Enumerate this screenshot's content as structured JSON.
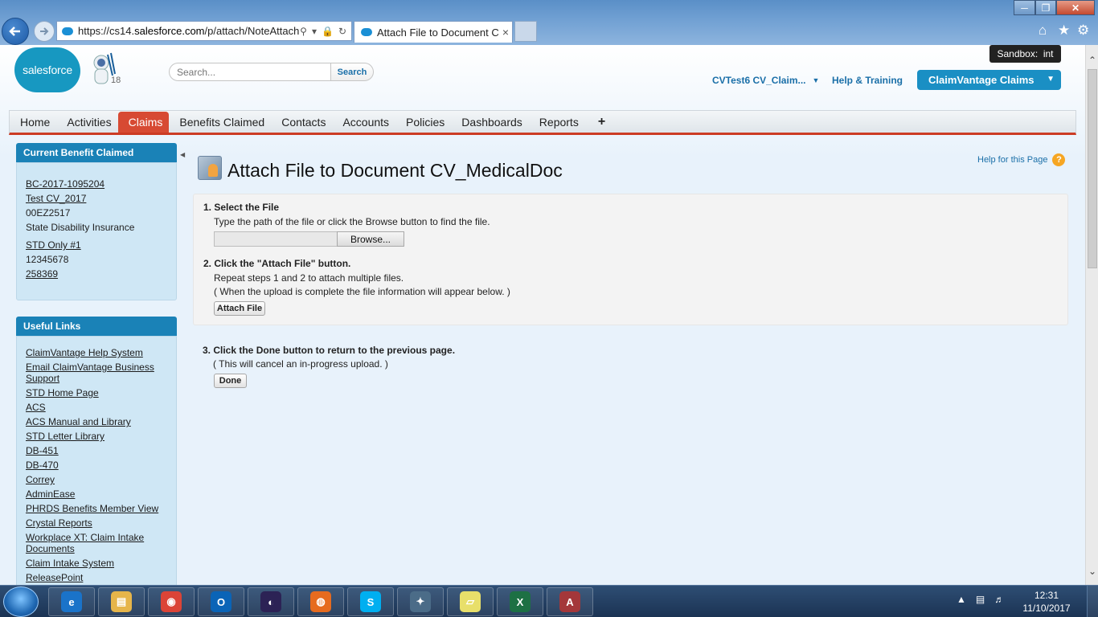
{
  "browser": {
    "url_prefix": "https://cs14.",
    "url_host": "salesforce.com",
    "url_rest": "/p/attach/NoteAttach?",
    "tab_title": "Attach File to Document C...",
    "tab_close": "×"
  },
  "header": {
    "logo_text": "salesforce",
    "mascot_count": "18",
    "search_placeholder": "Search...",
    "search_button": "Search",
    "user_menu": "CVTest6 CV_Claim...",
    "help_training": "Help & Training",
    "app_name": "ClaimVantage Claims",
    "sandbox_badge": "Sandbox:  int"
  },
  "tabs": [
    "Home",
    "Activities",
    "Claims",
    "Benefits Claimed",
    "Contacts",
    "Accounts",
    "Policies",
    "Dashboards",
    "Reports",
    "+"
  ],
  "active_tab": "Claims",
  "sidebar": {
    "current_heading": "Current Benefit Claimed",
    "current_items": [
      {
        "text": "BC-2017-1095204",
        "link": true
      },
      {
        "text": "Test CV_2017",
        "link": true
      },
      {
        "text": "00EZ2517",
        "link": false
      },
      {
        "text": "State Disability Insurance",
        "link": false
      },
      {
        "text": "STD Only #1",
        "link": true
      },
      {
        "text": "12345678",
        "link": false
      },
      {
        "text": "258369",
        "link": true
      }
    ],
    "links_heading": "Useful Links",
    "links": [
      "ClaimVantage Help System",
      "Email ClaimVantage Business Support",
      "STD Home Page",
      "ACS",
      "ACS Manual and Library",
      "STD Letter Library",
      "DB-451",
      "DB-470",
      "Correy",
      "AdminEase",
      "PHRDS Benefits Member View",
      "Crystal Reports",
      "Workplace XT: Claim Intake Documents",
      "Claim Intake System",
      "ReleasePoint"
    ]
  },
  "main": {
    "title": "Attach File to Document CV_MedicalDoc",
    "help_link": "Help for this Page",
    "help_icon": "?",
    "step1_title": "1.  Select the File",
    "step1_text": "Type the path of the file or click the Browse button to find the file.",
    "browse_button": "Browse...",
    "step2_title": "2.  Click the \"Attach File\" button.",
    "step2_text1": "Repeat steps 1 and 2 to attach multiple files.",
    "step2_text2": "( When the upload is complete the file information will appear below. )",
    "attach_button": "Attach File",
    "step3_title": "3.  Click the Done button to return to the previous page.",
    "step3_text": "( This will cancel an in-progress upload. )",
    "done_button": "Done"
  },
  "taskbar": {
    "apps": [
      "ie",
      "explorer",
      "chrome",
      "outlook",
      "eclipse",
      "firefox",
      "skype",
      "app",
      "sticky-notes",
      "excel",
      "access"
    ],
    "time": "12:31",
    "date": "11/10/2017"
  }
}
